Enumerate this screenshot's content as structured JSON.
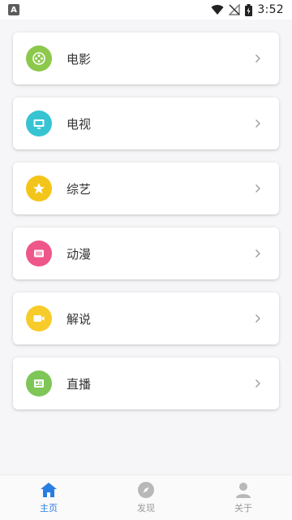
{
  "status_bar": {
    "notification_icon": "a-box-icon",
    "wifi_icon": "wifi-icon",
    "signal_icon": "no-signal-icon",
    "battery_icon": "battery-icon",
    "time": "3:52"
  },
  "categories": [
    {
      "label": "电影",
      "icon": "film-reel-icon",
      "color": "#8cc84b"
    },
    {
      "label": "电视",
      "icon": "tv-icon",
      "color": "#36c4d3"
    },
    {
      "label": "综艺",
      "icon": "star-icon",
      "color": "#f3c51b"
    },
    {
      "label": "动漫",
      "icon": "anime-icon",
      "color": "#ef5689"
    },
    {
      "label": "解说",
      "icon": "camera-icon",
      "color": "#f7cc2a"
    },
    {
      "label": "直播",
      "icon": "broadcast-icon",
      "color": "#7dc657"
    }
  ],
  "bottom_nav": [
    {
      "label": "主页",
      "icon": "home-icon",
      "active": true
    },
    {
      "label": "发现",
      "icon": "compass-icon",
      "active": false
    },
    {
      "label": "关于",
      "icon": "user-icon",
      "active": false
    }
  ],
  "colors": {
    "active": "#2a7de1",
    "inactive": "#9a9a9a"
  }
}
